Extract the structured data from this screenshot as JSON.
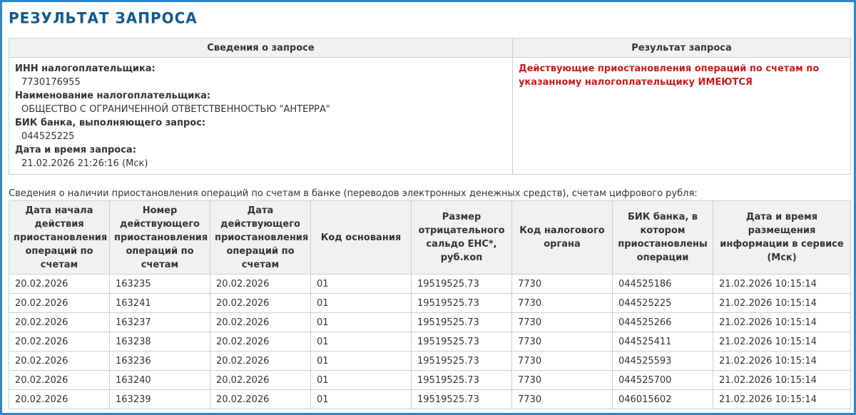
{
  "page": {
    "title": "РЕЗУЛЬТАТ ЗАПРОСА"
  },
  "request_info": {
    "header_left": "Сведения о запросе",
    "header_right": "Результат запроса",
    "fields": [
      {
        "label": "ИНН налогоплательщика:",
        "value": "7730176955"
      },
      {
        "label": "Наименование налогоплательщика:",
        "value": "ОБЩЕСТВО С ОГРАНИЧЕННОЙ ОТВЕТСТВЕННОСТЬЮ \"АНТЕРРА\""
      },
      {
        "label": "БИК банка, выполняющего запрос:",
        "value": "044525225"
      },
      {
        "label": "Дата и время запроса:",
        "value": "21.02.2026 21:26:16 (Мск)"
      }
    ],
    "result_text": "Действующие приостановления операций по счетам по указанному налогоплательщику ИМЕЮТСЯ",
    "result_color": "#cc1a1a"
  },
  "suspensions": {
    "caption": "Сведения о наличии приостановления операций по счетам в банке (переводов электронных денежных средств), счетам цифрового рубля:",
    "columns": [
      "Дата начала действия приостановления операций по счетам",
      "Номер действующего приостановления операций по счетам",
      "Дата действующего приостановления операций по счетам",
      "Код основания",
      "Размер отрицательного сальдо ЕНС*, руб.коп",
      "Код налогового органа",
      "БИК банка, в котором приостановлены операции",
      "Дата и время размещения информации в сервисе (Мск)"
    ],
    "rows": [
      [
        "20.02.2026",
        "163235",
        "20.02.2026",
        "01",
        "19519525.73",
        "7730",
        "044525186",
        "21.02.2026 10:15:14"
      ],
      [
        "20.02.2026",
        "163241",
        "20.02.2026",
        "01",
        "19519525.73",
        "7730",
        "044525225",
        "21.02.2026 10:15:14"
      ],
      [
        "20.02.2026",
        "163237",
        "20.02.2026",
        "01",
        "19519525.73",
        "7730",
        "044525266",
        "21.02.2026 10:15:14"
      ],
      [
        "20.02.2026",
        "163238",
        "20.02.2026",
        "01",
        "19519525.73",
        "7730",
        "044525411",
        "21.02.2026 10:15:14"
      ],
      [
        "20.02.2026",
        "163236",
        "20.02.2026",
        "01",
        "19519525.73",
        "7730",
        "044525593",
        "21.02.2026 10:15:14"
      ],
      [
        "20.02.2026",
        "163240",
        "20.02.2026",
        "01",
        "19519525.73",
        "7730",
        "044525700",
        "21.02.2026 10:15:14"
      ],
      [
        "20.02.2026",
        "163239",
        "20.02.2026",
        "01",
        "19519525.73",
        "7730",
        "046015602",
        "21.02.2026 10:15:14"
      ]
    ]
  }
}
